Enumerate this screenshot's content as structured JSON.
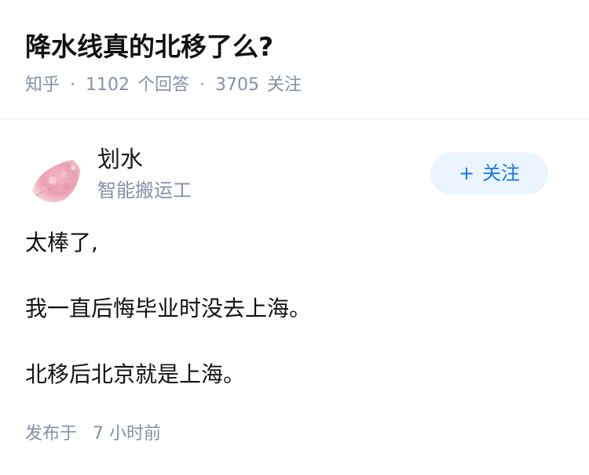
{
  "question": {
    "title": "降水线真的北移了么?",
    "meta": {
      "source": "知乎",
      "answers_count": "1102",
      "answers_label": "个回答",
      "followers_count": "3705",
      "followers_label": "关注"
    }
  },
  "answer": {
    "author": {
      "name": "划水",
      "bio": "智能搬运工",
      "avatar_icon": "pink-blossom-avatar"
    },
    "follow_button": {
      "icon": "+",
      "label": "关注"
    },
    "paragraphs": [
      "太棒了,",
      "我一直后悔毕业时没去上海。",
      "北移后北京就是上海。"
    ],
    "published": {
      "label": "发布于",
      "time": "7 小时前"
    }
  },
  "colors": {
    "follow_bg": "#ebf5ff",
    "follow_text": "#1772f6",
    "meta_gray": "#8590a6",
    "title": "#121212"
  }
}
